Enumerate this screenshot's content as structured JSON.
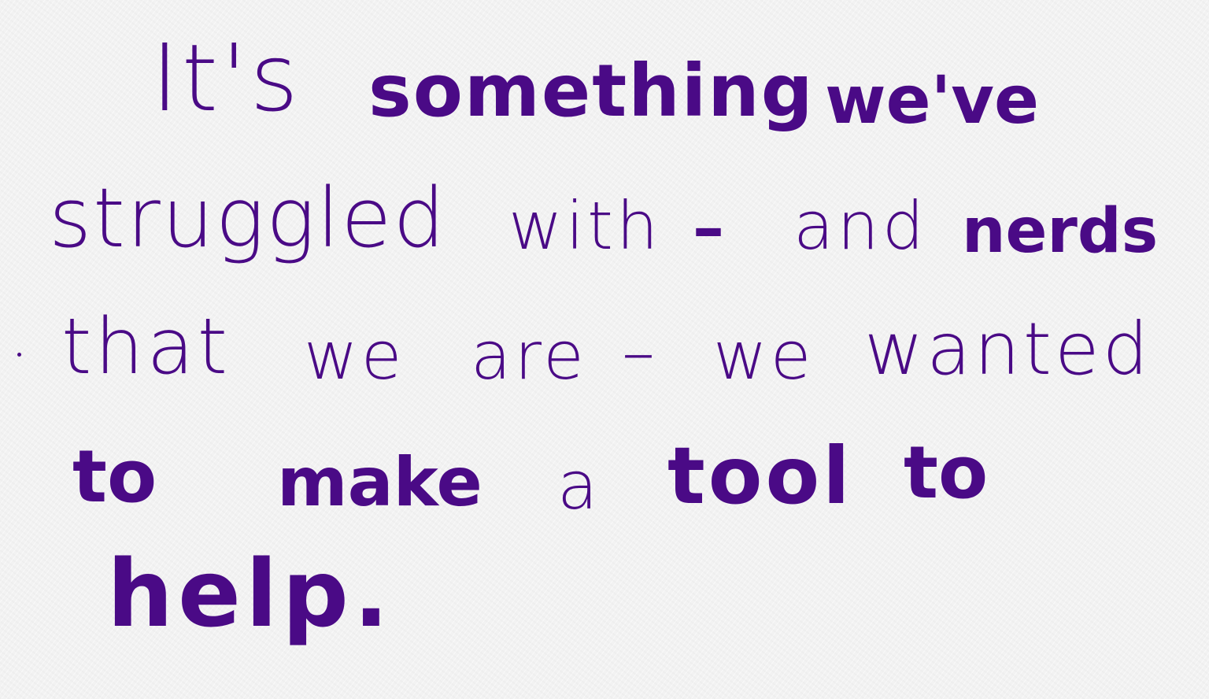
{
  "ink_color": "#4a0a86",
  "lines": [
    [
      "It's",
      "something",
      "we've"
    ],
    [
      "struggled",
      "with",
      "–",
      "and",
      "nerds"
    ],
    [
      "that",
      "we",
      "are",
      "–",
      "we",
      "wanted"
    ],
    [
      "to",
      "make",
      "a",
      "tool",
      "to"
    ],
    [
      "help."
    ]
  ]
}
